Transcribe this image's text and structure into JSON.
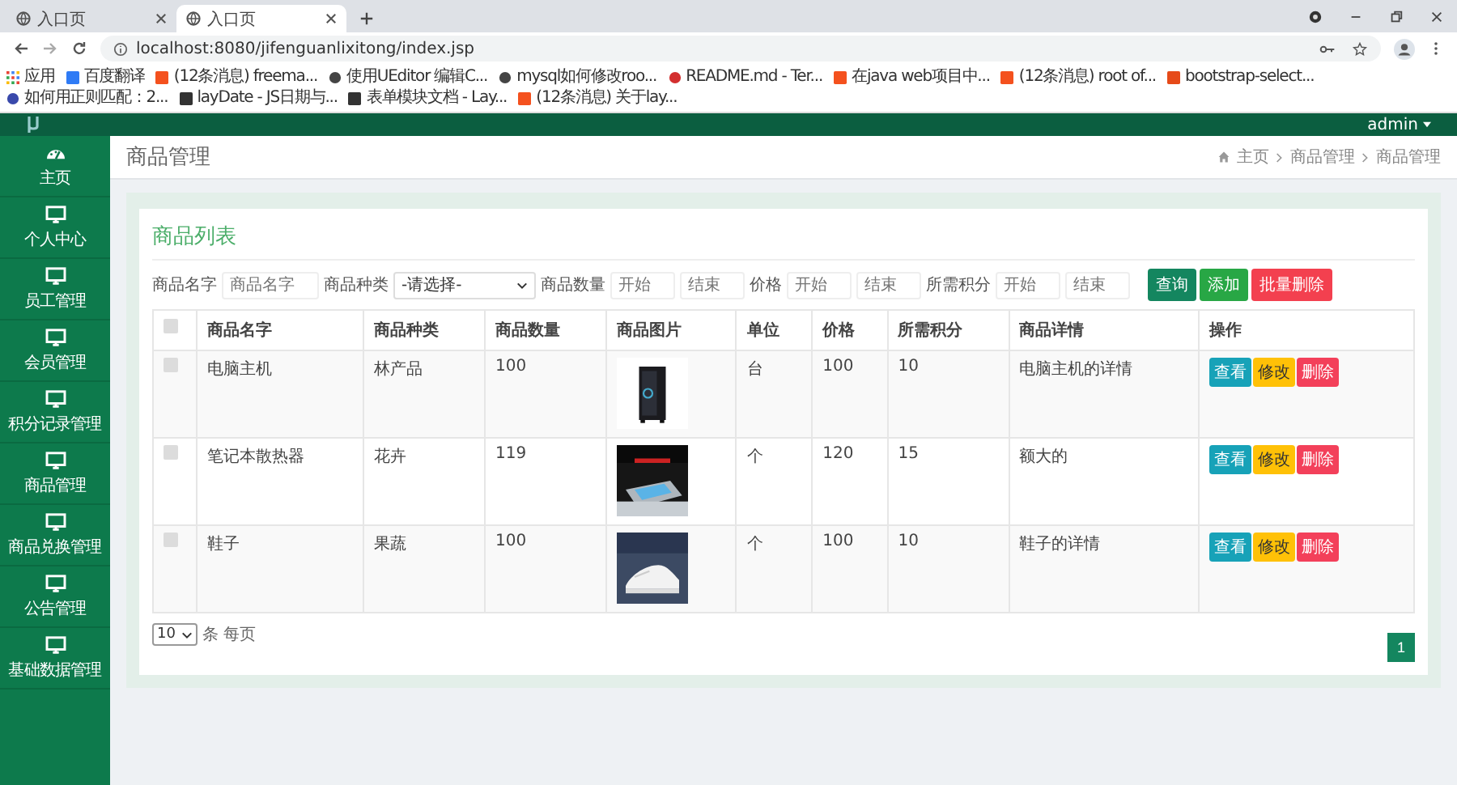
{
  "browser": {
    "tabs": [
      {
        "title": "入口页",
        "selected": false
      },
      {
        "title": "入口页",
        "selected": true
      }
    ],
    "address": "localhost:8080/jifenguanlixitong/index.jsp",
    "bookmarks": [
      {
        "label": "应用",
        "kind": "apps"
      },
      {
        "label": "百度翻译",
        "kind": "translate"
      },
      {
        "label": "(12条消息) freema...",
        "kind": "csdn"
      },
      {
        "label": "使用UEditor 编辑C...",
        "kind": "github"
      },
      {
        "label": "mysql如何修改roo...",
        "kind": "github"
      },
      {
        "label": "README.md - Ter...",
        "kind": "readme"
      },
      {
        "label": "在java web项目中...",
        "kind": "csdn"
      },
      {
        "label": "(12条消息) root of...",
        "kind": "csdn"
      },
      {
        "label": "bootstrap-select...",
        "kind": "bootstrap"
      },
      {
        "label": "如何用正则匹配：2...",
        "kind": "paw"
      },
      {
        "label": "layDate - JS日期与...",
        "kind": "layui"
      },
      {
        "label": "表单模块文档 - Lay...",
        "kind": "layui"
      },
      {
        "label": "(12条消息) 关于lay...",
        "kind": "csdn"
      }
    ]
  },
  "app": {
    "user": "admin"
  },
  "sidebar": {
    "items": [
      {
        "label": "主页",
        "kind": "dashboard"
      },
      {
        "label": "个人中心",
        "kind": "monitor"
      },
      {
        "label": "员工管理",
        "kind": "monitor"
      },
      {
        "label": "会员管理",
        "kind": "monitor"
      },
      {
        "label": "积分记录管理",
        "kind": "monitor"
      },
      {
        "label": "商品管理",
        "kind": "monitor"
      },
      {
        "label": "商品兑换管理",
        "kind": "monitor"
      },
      {
        "label": "公告管理",
        "kind": "monitor"
      },
      {
        "label": "基础数据管理",
        "kind": "monitor"
      }
    ]
  },
  "page": {
    "title": "商品管理",
    "breadcrumb": [
      "主页",
      "商品管理",
      "商品管理"
    ]
  },
  "card": {
    "title": "商品列表",
    "filters": [
      {
        "kind": "label",
        "text": "商品名字"
      },
      {
        "kind": "input",
        "placeholder": "商品名字"
      },
      {
        "kind": "label",
        "text": "商品种类"
      },
      {
        "kind": "select",
        "value": "-请选择-"
      },
      {
        "kind": "label",
        "text": "商品数量"
      },
      {
        "kind": "input",
        "placeholder": "开始"
      },
      {
        "kind": "input",
        "placeholder": "结束"
      },
      {
        "kind": "label",
        "text": "价格"
      },
      {
        "kind": "input",
        "placeholder": "开始"
      },
      {
        "kind": "input",
        "placeholder": "结束"
      },
      {
        "kind": "label",
        "text": "所需积分"
      },
      {
        "kind": "input",
        "placeholder": "开始"
      },
      {
        "kind": "input",
        "placeholder": "结束"
      }
    ],
    "buttons": [
      {
        "label": "查询",
        "kind": "query"
      },
      {
        "label": "添加",
        "kind": "add"
      },
      {
        "label": "批量删除",
        "kind": "delete"
      }
    ],
    "table": {
      "select_all": {
        "checked": false
      },
      "columns": [
        "商品名字",
        "商品种类",
        "商品数量",
        "商品图片",
        "单位",
        "价格",
        "所需积分",
        "商品详情",
        "操作"
      ],
      "rows": [
        {
          "checked": false,
          "name": "电脑主机",
          "category": "林产品",
          "quantity": "100",
          "unit": "台",
          "price": "100",
          "points": "10",
          "detail": "电脑主机的详情",
          "actions": [
            {
              "label": "查看",
              "kind": "view"
            },
            {
              "label": "修改",
              "kind": "edit"
            },
            {
              "label": "删除",
              "kind": "delete"
            }
          ]
        },
        {
          "checked": false,
          "name": "笔记本散热器",
          "category": "花卉",
          "quantity": "119",
          "unit": "个",
          "price": "120",
          "points": "15",
          "detail": "额大的",
          "actions": [
            {
              "label": "查看",
              "kind": "view"
            },
            {
              "label": "修改",
              "kind": "edit"
            },
            {
              "label": "删除",
              "kind": "delete"
            }
          ]
        },
        {
          "checked": false,
          "name": "鞋子",
          "category": "果蔬",
          "quantity": "100",
          "unit": "个",
          "price": "100",
          "points": "10",
          "detail": "鞋子的详情",
          "actions": [
            {
              "label": "查看",
              "kind": "view"
            },
            {
              "label": "修改",
              "kind": "edit"
            },
            {
              "label": "删除",
              "kind": "delete"
            }
          ]
        }
      ]
    },
    "pager": {
      "page_size": "10",
      "per_page_label": "条 每页",
      "pages": [
        {
          "label": "1",
          "selected": true
        }
      ]
    }
  }
}
